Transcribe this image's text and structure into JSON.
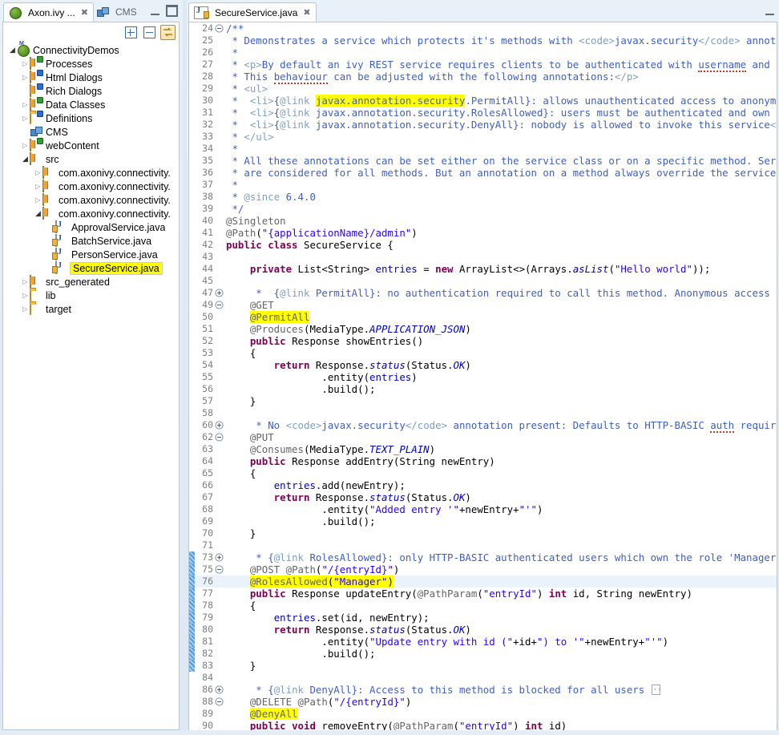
{
  "window": {
    "left_view_tabs": [
      {
        "label": "Axon.ivy ...",
        "icon": "ivy-globe-icon",
        "active": true,
        "closeable": true
      },
      {
        "label": "CMS",
        "icon": "cms-cubes-icon",
        "active": false,
        "closeable": false
      }
    ],
    "minimize_label": "Minimize",
    "maximize_label": "Maximize"
  },
  "view_toolbar": {
    "expand_all_label": "Expand All",
    "collapse_all_label": "Collapse All",
    "link_with_editor_label": "Link with Editor"
  },
  "tree": [
    {
      "label": "ConnectivityDemos",
      "indent": 0,
      "arrow": "open",
      "icon": "ivy-project-icon"
    },
    {
      "label": "Processes",
      "indent": 1,
      "arrow": "closed",
      "icon": "processes-folder-icon"
    },
    {
      "label": "Html Dialogs",
      "indent": 1,
      "arrow": "closed",
      "icon": "html-dialogs-folder-icon"
    },
    {
      "label": "Rich Dialogs",
      "indent": 1,
      "arrow": "none",
      "icon": "rich-dialogs-folder-icon"
    },
    {
      "label": "Data Classes",
      "indent": 1,
      "arrow": "closed",
      "icon": "data-classes-folder-icon"
    },
    {
      "label": "Definitions",
      "indent": 1,
      "arrow": "closed",
      "icon": "definitions-folder-icon"
    },
    {
      "label": "CMS",
      "indent": 1,
      "arrow": "none",
      "icon": "cms-cubes-icon"
    },
    {
      "label": "webContent",
      "indent": 1,
      "arrow": "closed",
      "icon": "webcontent-folder-icon"
    },
    {
      "label": "src",
      "indent": 1,
      "arrow": "open",
      "icon": "source-folder-icon"
    },
    {
      "label": "com.axonivy.connectivity.",
      "indent": 2,
      "arrow": "closed",
      "icon": "package-icon"
    },
    {
      "label": "com.axonivy.connectivity.",
      "indent": 2,
      "arrow": "closed",
      "icon": "package-icon"
    },
    {
      "label": "com.axonivy.connectivity.",
      "indent": 2,
      "arrow": "closed",
      "icon": "package-icon"
    },
    {
      "label": "com.axonivy.connectivity.",
      "indent": 2,
      "arrow": "open",
      "icon": "package-icon"
    },
    {
      "label": "ApprovalService.java",
      "indent": 3,
      "arrow": "none",
      "icon": "java-file-icon"
    },
    {
      "label": "BatchService.java",
      "indent": 3,
      "arrow": "none",
      "icon": "java-file-icon"
    },
    {
      "label": "PersonService.java",
      "indent": 3,
      "arrow": "none",
      "icon": "java-file-icon"
    },
    {
      "label": "SecureService.java",
      "indent": 3,
      "arrow": "none",
      "icon": "java-file-icon",
      "selected": true
    },
    {
      "label": "src_generated",
      "indent": 1,
      "arrow": "closed",
      "icon": "source-folder-icon"
    },
    {
      "label": "lib",
      "indent": 1,
      "arrow": "closed",
      "icon": "lib-folder-icon"
    },
    {
      "label": "target",
      "indent": 1,
      "arrow": "closed",
      "icon": "folder-icon"
    }
  ],
  "editor": {
    "tab_label": "SecureService.java",
    "tab_icon": "java-file-icon",
    "dirty": false,
    "current_line": 76,
    "colors": {
      "comment": "#3f5fbf",
      "javadoc_tag": "#7f9fbf",
      "keyword": "#7f0055",
      "string": "#2a00ff",
      "annotation": "#646464",
      "field": "#0000c0",
      "highlight": "#ffff00",
      "current_line_bg": "#eaf2fb",
      "change_bar": "#5b9bd5"
    },
    "lines": [
      {
        "n": "24",
        "fold": "collapse"
      },
      {
        "n": "25"
      },
      {
        "n": "26"
      },
      {
        "n": "27"
      },
      {
        "n": "28"
      },
      {
        "n": "29"
      },
      {
        "n": "30"
      },
      {
        "n": "31"
      },
      {
        "n": "32"
      },
      {
        "n": "33"
      },
      {
        "n": "34"
      },
      {
        "n": "35"
      },
      {
        "n": "36"
      },
      {
        "n": "37"
      },
      {
        "n": "38"
      },
      {
        "n": "39"
      },
      {
        "n": "40"
      },
      {
        "n": "41"
      },
      {
        "n": "42"
      },
      {
        "n": "43"
      },
      {
        "n": "44"
      },
      {
        "n": "45"
      },
      {
        "n": "47",
        "fold": "expand"
      },
      {
        "n": "49",
        "fold": "collapse"
      },
      {
        "n": "50"
      },
      {
        "n": "51"
      },
      {
        "n": "52"
      },
      {
        "n": "53"
      },
      {
        "n": "54"
      },
      {
        "n": "55"
      },
      {
        "n": "56"
      },
      {
        "n": "57"
      },
      {
        "n": "58"
      },
      {
        "n": "60",
        "fold": "expand"
      },
      {
        "n": "62",
        "fold": "collapse"
      },
      {
        "n": "63"
      },
      {
        "n": "64"
      },
      {
        "n": "65"
      },
      {
        "n": "66"
      },
      {
        "n": "67"
      },
      {
        "n": "68"
      },
      {
        "n": "69"
      },
      {
        "n": "70"
      },
      {
        "n": "71"
      },
      {
        "n": "73",
        "fold": "expand",
        "changed": true
      },
      {
        "n": "75",
        "fold": "collapse",
        "changed": true
      },
      {
        "n": "76",
        "changed": true,
        "current": true
      },
      {
        "n": "77",
        "changed": true
      },
      {
        "n": "78",
        "changed": true
      },
      {
        "n": "79",
        "changed": true
      },
      {
        "n": "80",
        "changed": true
      },
      {
        "n": "81",
        "changed": true
      },
      {
        "n": "82",
        "changed": true
      },
      {
        "n": "83",
        "changed": true
      },
      {
        "n": "84"
      },
      {
        "n": "86",
        "fold": "expand"
      },
      {
        "n": "88",
        "fold": "collapse"
      },
      {
        "n": "89"
      },
      {
        "n": "90"
      }
    ],
    "source_text": [
      "/**",
      " * Demonstrates a service which protects it's methods with <code>javax.security</code> annotations.",
      " *",
      " * <p>By default an ivy REST service requires clients to be authenticated with username and password",
      " * This behaviour can be adjusted with the following annotations:</p>",
      " * <ul>",
      " *  <li>{@link javax.annotation.security.PermitAll}: allows unauthenticated access to anonymous user",
      " *  <li>{@link javax.annotation.security.RolesAllowed}: users must be authenticated and own the defi",
      " *  <li>{@link javax.annotation.security.DenyAll}: nobody is allowed to invoke this service</li>",
      " * </ul>",
      " *",
      " * All these annotations can be set either on the service class or on a specific method. Service cla",
      " * are considered for all methods. But an annotation on a method always override the service class a",
      " *",
      " * @since 6.4.0",
      " */",
      "@Singleton",
      "@Path(\"{applicationName}/admin\")",
      "public class SecureService {",
      "",
      "    private List<String> entries = new ArrayList<>(Arrays.asList(\"Hello world\"));",
      "",
      "     *  {@link PermitAll}: no authentication required to call this method. Anonymous access granted.",
      "    @GET",
      "    @PermitAll",
      "    @Produces(MediaType.APPLICATION_JSON)",
      "    public Response showEntries()",
      "    {",
      "        return Response.status(Status.OK)",
      "                .entity(entries)",
      "                .build();",
      "    }",
      "",
      "     * No <code>javax.security</code> annotation present: Defaults to HTTP-BASIC auth required.",
      "    @PUT",
      "    @Consumes(MediaType.TEXT_PLAIN)",
      "    public Response addEntry(String newEntry)",
      "    {",
      "        entries.add(newEntry);",
      "        return Response.status(Status.OK)",
      "                .entity(\"Added entry '\"+newEntry+\"'\")",
      "                .build();",
      "    }",
      "",
      "     * {@link RolesAllowed}: only HTTP-BASIC authenticated users which own the role 'Manager' are al",
      "    @POST @Path(\"/{entryId}\")",
      "    @RolesAllowed(\"Manager\")",
      "    public Response updateEntry(@PathParam(\"entryId\") int id, String newEntry)",
      "    {",
      "        entries.set(id, newEntry);",
      "        return Response.status(Status.OK)",
      "                .entity(\"Update entry with id (\"+id+\") to '\"+newEntry+\"'\")",
      "                .build();",
      "    }",
      "",
      "     * {@link DenyAll}: Access to this method is blocked for all users",
      "    @DELETE @Path(\"/{entryId}\")",
      "    @DenyAll",
      "    public void removeEntry(@PathParam(\"entryId\") int id)"
    ],
    "highlighted_tokens": [
      "javax.annotation.security",
      "@PermitAll",
      "@RolesAllowed(\"Manager\")",
      "@DenyAll"
    ],
    "spellcheck_warnings": [
      "behaviour",
      "username",
      "auth"
    ]
  }
}
